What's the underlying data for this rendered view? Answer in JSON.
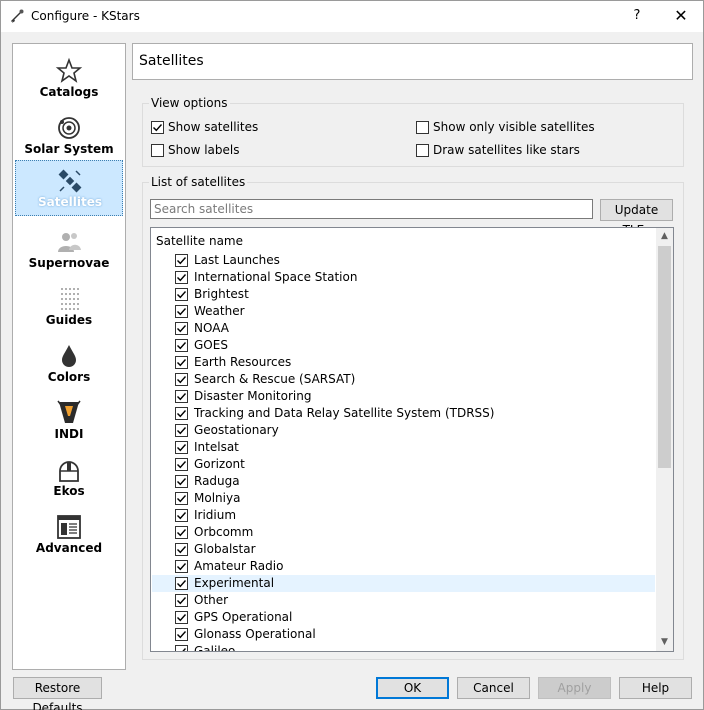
{
  "window": {
    "title": "Configure - KStars",
    "help_glyph": "?",
    "close_glyph": "✕"
  },
  "sidebar": {
    "items": [
      {
        "label": "Catalogs",
        "icon": "star-outline-icon"
      },
      {
        "label": "Solar System",
        "icon": "solar-system-icon"
      },
      {
        "label": "Satellites",
        "icon": "satellite-icon",
        "selected": true
      },
      {
        "label": "Supernovae",
        "icon": "supernovae-icon"
      },
      {
        "label": "Guides",
        "icon": "guides-dots-icon"
      },
      {
        "label": "Colors",
        "icon": "color-drop-icon"
      },
      {
        "label": "INDI",
        "icon": "indi-icon"
      },
      {
        "label": "Ekos",
        "icon": "ekos-dome-icon"
      },
      {
        "label": "Advanced",
        "icon": "advanced-window-icon"
      }
    ]
  },
  "page": {
    "title": "Satellites",
    "view_options": {
      "title": "View options",
      "show_satellites": {
        "label": "Show satellites",
        "checked": true
      },
      "show_labels": {
        "label": "Show labels",
        "checked": false
      },
      "show_only_visible": {
        "label": "Show only visible satellites",
        "checked": false
      },
      "draw_like_stars": {
        "label": "Draw satellites like stars",
        "checked": false
      }
    },
    "list_group": {
      "title": "List of satellites",
      "search_placeholder": "Search satellites",
      "update_button": "Update TLEs",
      "column_header": "Satellite name",
      "items": [
        "Last Launches",
        "International Space Station",
        "Brightest",
        "Weather",
        "NOAA",
        "GOES",
        "Earth Resources",
        "Search & Rescue (SARSAT)",
        "Disaster Monitoring",
        "Tracking and Data Relay Satellite System (TDRSS)",
        "Geostationary",
        "Intelsat",
        "Gorizont",
        "Raduga",
        "Molniya",
        "Iridium",
        "Orbcomm",
        "Globalstar",
        "Amateur Radio",
        "Experimental",
        "Other",
        "GPS Operational",
        "Glonass Operational",
        "Galileo"
      ],
      "hovered_index": 19
    }
  },
  "footer": {
    "restore_defaults": "Restore Defaults",
    "ok": "OK",
    "cancel": "Cancel",
    "apply": "Apply",
    "help": "Help"
  },
  "colors": {
    "selection": "#cce8ff",
    "accent": "#0078d7"
  }
}
